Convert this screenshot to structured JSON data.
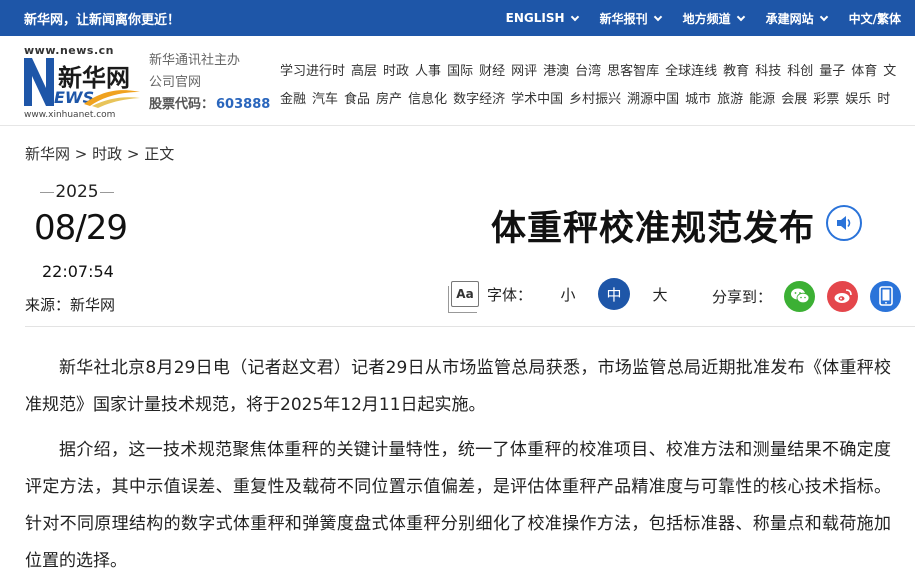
{
  "topbar": {
    "slogan": "新华网，让新闻离你更近！",
    "nav": [
      "ENGLISH",
      "新华报刊",
      "地方频道",
      "承建网站",
      "中文/繁体"
    ]
  },
  "header": {
    "logo": {
      "url_top": "www.news.cn",
      "cn_name": "新华网",
      "ews": "EWS",
      "url_bottom": "www.xinhuanet.com"
    },
    "org_line1": "新华通讯社主办",
    "org_line2": "公司官网",
    "stock_label": "股票代码：",
    "stock_code": "603888",
    "channels_row1": [
      "学习进行时",
      "高层",
      "时政",
      "人事",
      "国际",
      "财经",
      "网评",
      "港澳",
      "台湾",
      "思客智库",
      "全球连线",
      "教育",
      "科技",
      "科创",
      "量子",
      "体育",
      "文"
    ],
    "channels_row2": [
      "金融",
      "汽车",
      "食品",
      "房产",
      "信息化",
      "数字经济",
      "学术中国",
      "乡村振兴",
      "溯源中国",
      "城市",
      "旅游",
      "能源",
      "会展",
      "彩票",
      "娱乐",
      "时"
    ]
  },
  "breadcrumb": {
    "home": "新华网",
    "sep1": " > ",
    "section": "时政",
    "sep2": " > ",
    "current": "正文"
  },
  "meta": {
    "year": "2025",
    "month_day": "08/29",
    "time": "22:07:54",
    "source": "来源：新华网"
  },
  "article": {
    "title": "体重秤校准规范发布",
    "font_label": "字体：",
    "font_sizes": [
      "小",
      "中",
      "大"
    ],
    "font_icon_text": "Aa",
    "share_label": "分享到：",
    "paragraphs": [
      "新华社北京8月29日电（记者赵文君）记者29日从市场监管总局获悉，市场监管总局近期批准发布《体重秤校准规范》国家计量技术规范，将于2025年12月11日起实施。",
      "据介绍，这一技术规范聚焦体重秤的关键计量特性，统一了体重秤的校准项目、校准方法和测量结果不确定度评定方法，其中示值误差、重复性及载荷不同位置示值偏差，是评估体重秤产品精准度与可靠性的核心技术指标。针对不同原理结构的数字式体重秤和弹簧度盘式体重秤分别细化了校准操作方法，包括标准器、称量点和载荷施加位置的选择。"
    ]
  },
  "icons": {
    "audio": "speaker-icon",
    "font": "font-size-icon",
    "wechat": "wechat-icon",
    "weibo": "weibo-icon",
    "mobile": "mobile-icon"
  },
  "colors": {
    "brand_blue": "#1e56a8",
    "link_blue": "#2a73d9",
    "wechat_green": "#3cb034",
    "weibo_red": "#e4464b"
  }
}
